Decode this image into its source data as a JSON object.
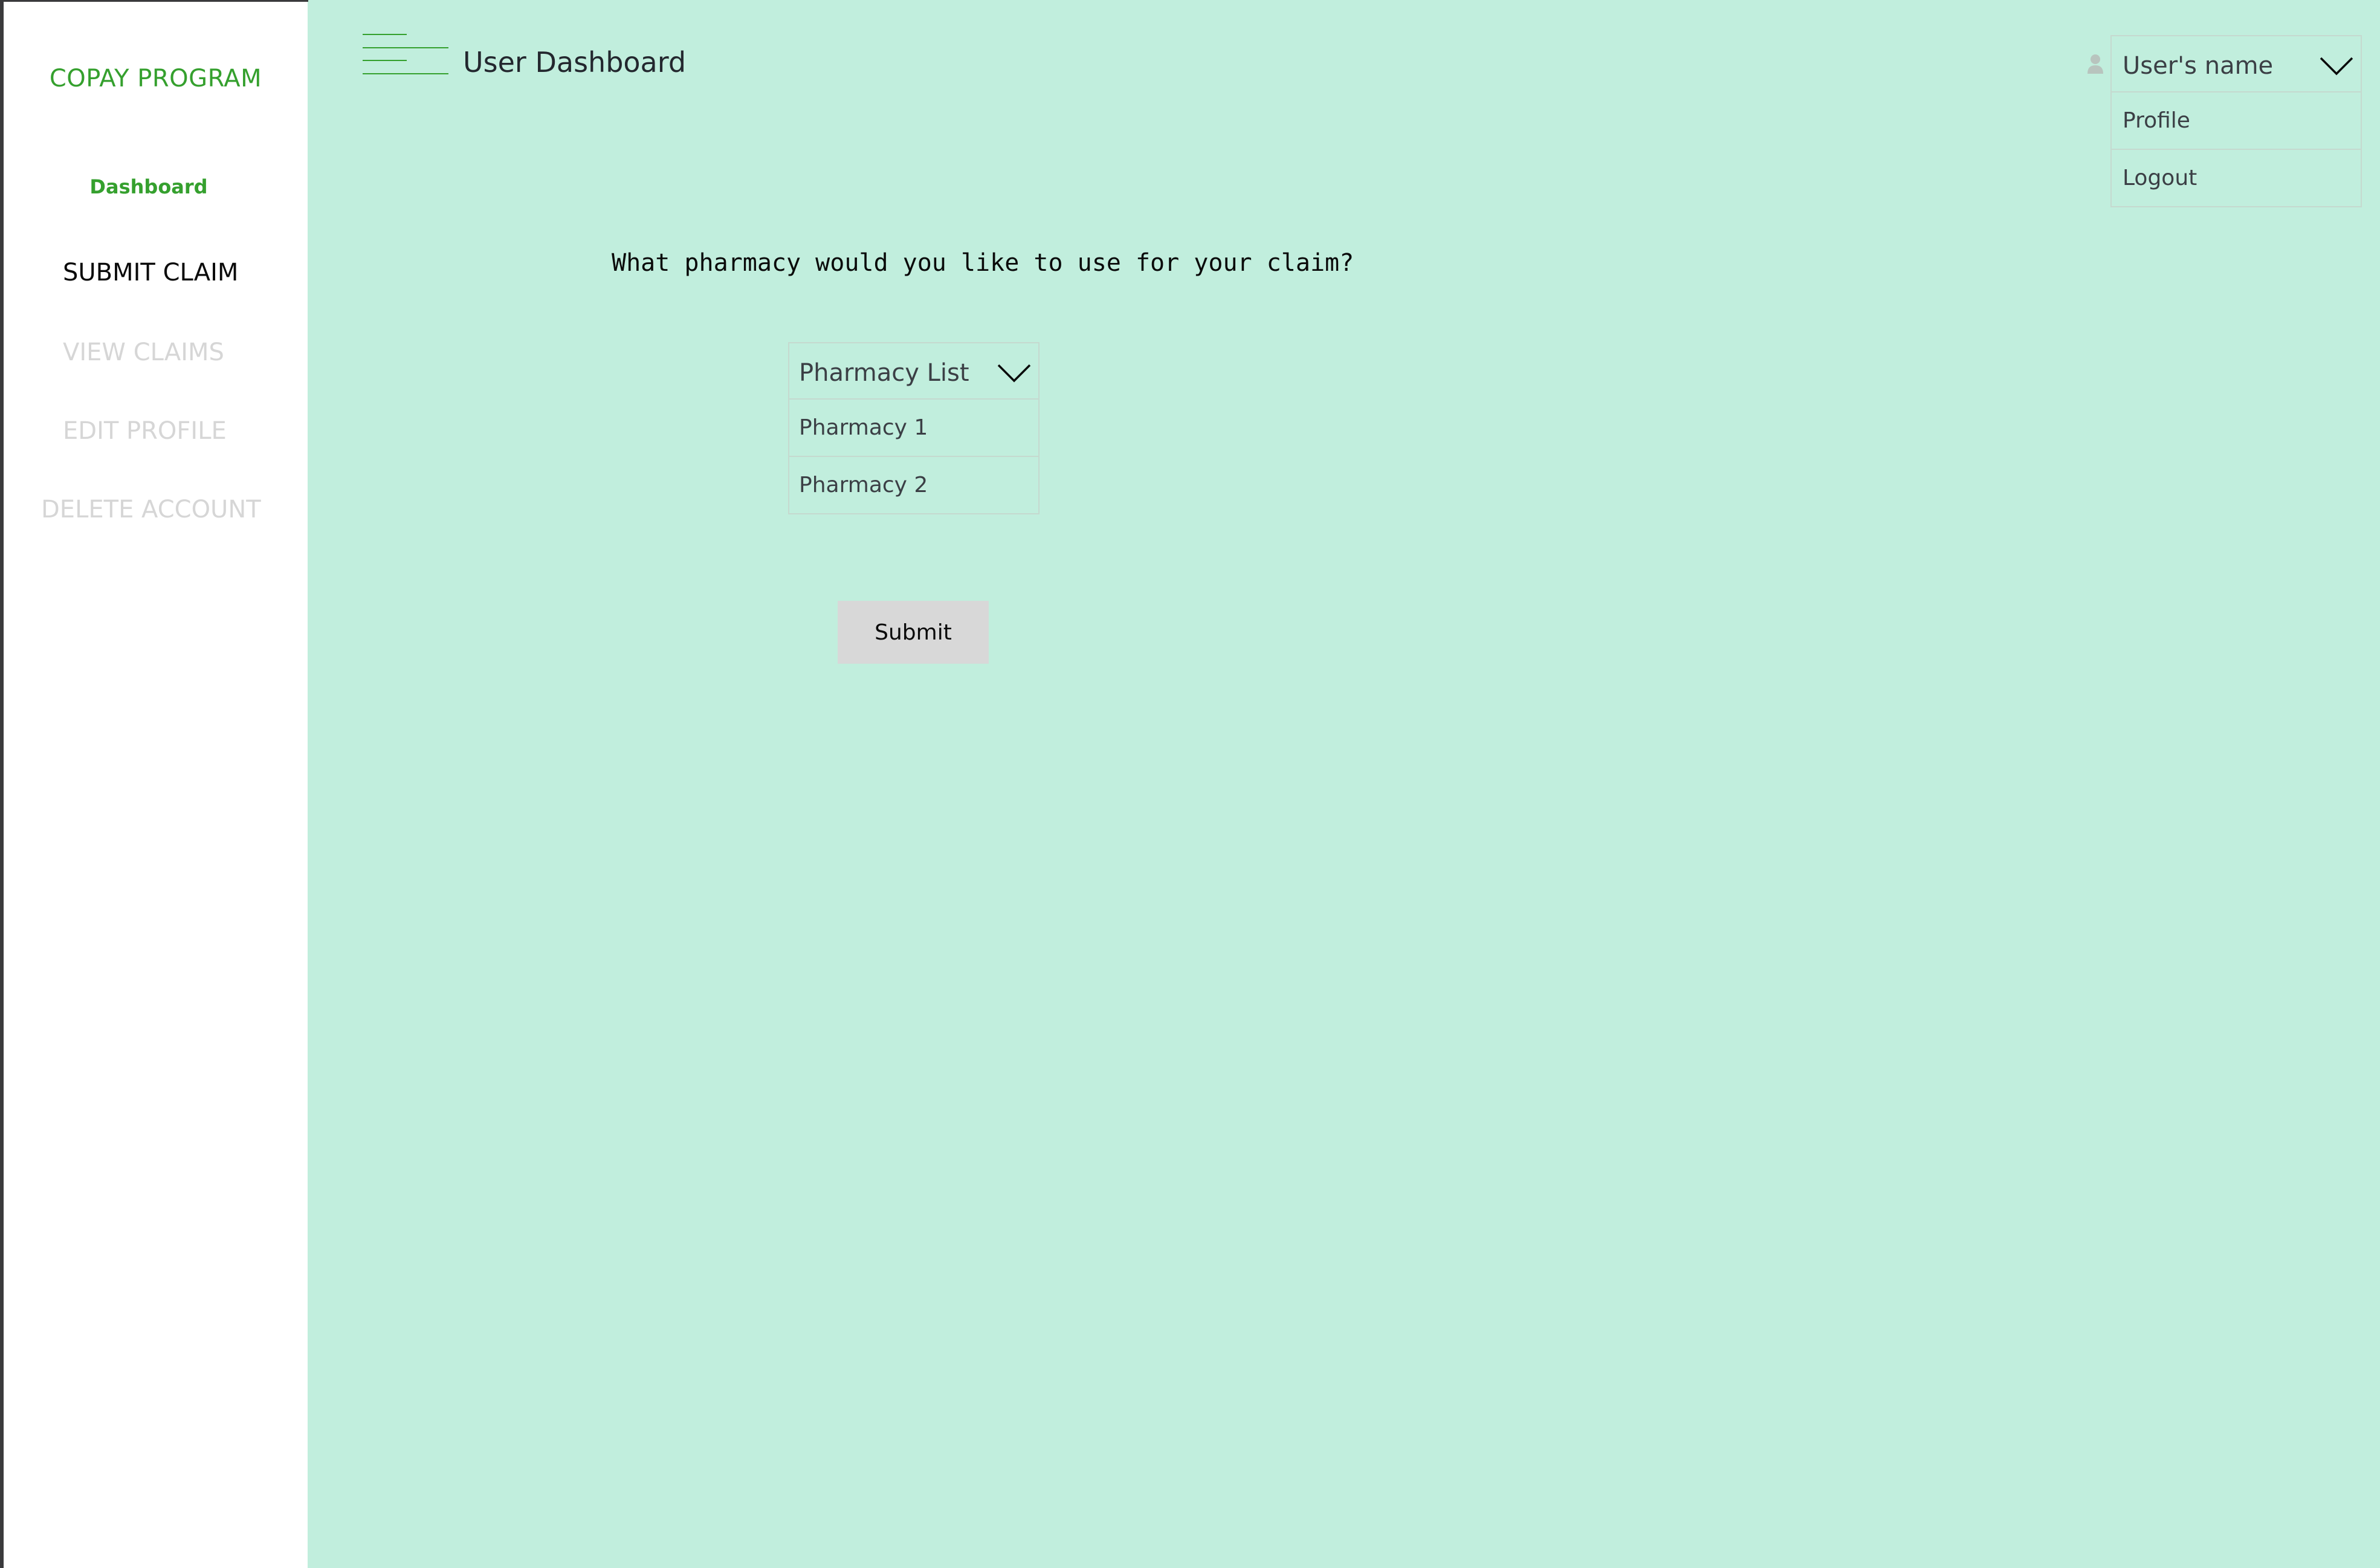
{
  "app": {
    "brand": "COPAY PROGRAM"
  },
  "sidebar": {
    "items": [
      {
        "label": "Dashboard",
        "state": "current"
      },
      {
        "label": "SUBMIT CLAIM",
        "state": "active"
      },
      {
        "label": "VIEW CLAIMS",
        "state": "disabled"
      },
      {
        "label": "EDIT PROFILE",
        "state": "disabled"
      },
      {
        "label": "DELETE ACCOUNT",
        "state": "disabled"
      }
    ]
  },
  "header": {
    "title": "User Dashboard",
    "menu_icon": "hamburger-menu-icon"
  },
  "user_menu": {
    "icon": "user-icon",
    "label": "User's name",
    "options": [
      "Profile",
      "Logout"
    ]
  },
  "main": {
    "question": "What pharmacy would you like to use for your claim?",
    "pharmacy_dropdown": {
      "label": "Pharmacy List",
      "options": [
        "Pharmacy 1",
        "Pharmacy 2"
      ]
    },
    "submit_label": "Submit"
  },
  "colors": {
    "background": "#c1eedd",
    "sidebar": "#ffffff",
    "brand": "#35a02e",
    "disabled_text": "#d6d6d6",
    "button": "#d8d8d8",
    "border": "#c5d9cf"
  }
}
